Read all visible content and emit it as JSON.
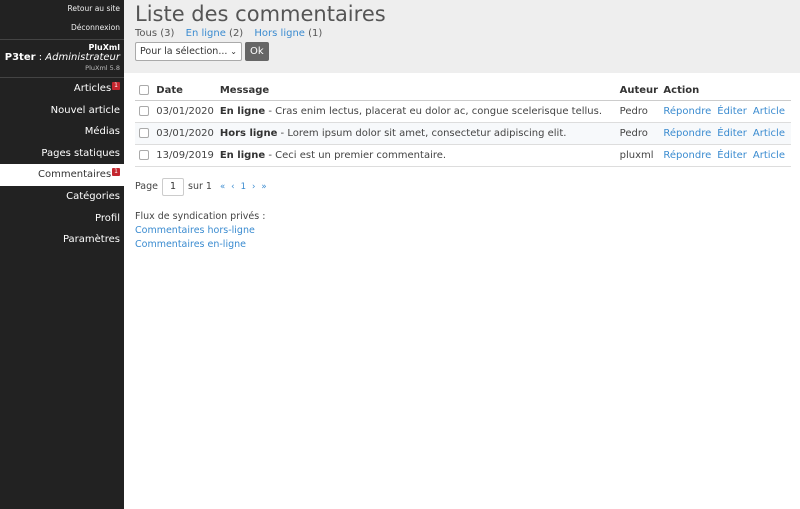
{
  "sidebar": {
    "back_link": "Retour au site",
    "logout_link": "Déconnexion",
    "brand": "PluXml",
    "user_name": "P3ter",
    "user_sep": " : ",
    "user_role": "Administrateur",
    "version": "PluXml 5.8",
    "menu": [
      {
        "label": "Articles",
        "badge": "1"
      },
      {
        "label": "Nouvel article",
        "badge": ""
      },
      {
        "label": "Médias",
        "badge": ""
      },
      {
        "label": "Pages statiques",
        "badge": ""
      },
      {
        "label": "Commentaires",
        "badge": "1"
      },
      {
        "label": "Catégories",
        "badge": ""
      },
      {
        "label": "Profil",
        "badge": ""
      },
      {
        "label": "Paramètres",
        "badge": ""
      }
    ]
  },
  "header": {
    "title": "Liste des commentaires",
    "filters": [
      {
        "label": "Tous",
        "count": "(3)"
      },
      {
        "label": "En ligne",
        "count": "(2)"
      },
      {
        "label": "Hors ligne",
        "count": "(1)"
      }
    ],
    "select_value": "Pour la sélection...",
    "ok_label": "Ok"
  },
  "table": {
    "headers": {
      "date": "Date",
      "message": "Message",
      "author": "Auteur",
      "action": "Action"
    },
    "rows": [
      {
        "date": "03/01/2020",
        "status": "En ligne",
        "text": " - Cras enim lectus, placerat eu dolor ac, congue scelerisque tellus.",
        "author": "Pedro",
        "reply": "Répondre",
        "edit": "Éditer",
        "article": "Article"
      },
      {
        "date": "03/01/2020",
        "status": "Hors ligne",
        "text": " - Lorem ipsum dolor sit amet, consectetur adipiscing elit.",
        "author": "Pedro",
        "reply": "Répondre",
        "edit": "Éditer",
        "article": "Article"
      },
      {
        "date": "13/09/2019",
        "status": "En ligne",
        "text": " - Ceci est un premier commentaire.",
        "author": "pluxml",
        "reply": "Répondre",
        "edit": "Éditer",
        "article": "Article"
      }
    ]
  },
  "pagination": {
    "page_label": "Page",
    "page_value": "1",
    "of_label": "sur 1",
    "first": "«",
    "prev": "‹",
    "current": "1",
    "next": "›",
    "last": "»"
  },
  "syndication": {
    "label": "Flux de syndication privés :",
    "offline_link": "Commentaires hors-ligne",
    "online_link": "Commentaires en-ligne"
  },
  "colors": {
    "sidebar_bg": "#222222",
    "header_bg": "#eeeeee",
    "link": "#3a8bd0",
    "badge": "#c3262e"
  }
}
